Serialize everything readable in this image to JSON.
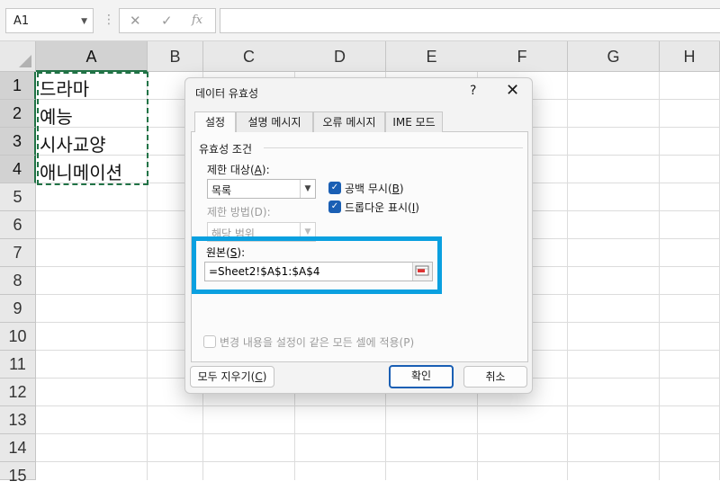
{
  "formula_bar": {
    "name_box": "A1",
    "name_box_icon": "chevron-down-icon",
    "separator": "⋮",
    "cancel_icon": "✕",
    "enter_icon": "✓",
    "fx_label": "fx",
    "formula": ""
  },
  "grid": {
    "columns": [
      "A",
      "B",
      "C",
      "D",
      "E",
      "F",
      "G",
      "H"
    ],
    "rows": [
      "1",
      "2",
      "3",
      "4",
      "5",
      "6",
      "7",
      "8",
      "9",
      "10",
      "11",
      "12",
      "13",
      "14",
      "15"
    ],
    "cells": {
      "A1": "드라마",
      "A2": "예능",
      "A3": "시사교양",
      "A4": "애니메이션"
    },
    "selected_column": "A",
    "selected_rows": [
      "1",
      "2",
      "3",
      "4"
    ],
    "accent": "#217346"
  },
  "dialog": {
    "title": "데이터 유효성",
    "help": "?",
    "close": "✕",
    "tabs": [
      {
        "label": "설정",
        "active": true
      },
      {
        "label": "설명 메시지",
        "active": false
      },
      {
        "label": "오류 메시지",
        "active": false
      },
      {
        "label": "IME 모드",
        "active": false
      }
    ],
    "section_title": "유효성 조건",
    "allow_label": "제한 대상(",
    "allow_key": "A",
    "allow_suffix": "):",
    "allow_value": "목록",
    "ignore_blank_label": "공백 무시(",
    "ignore_blank_key": "B",
    "ignore_blank_suffix": ")",
    "ignore_blank_checked": true,
    "dropdown_label": "드롭다운 표시(",
    "dropdown_key": "I",
    "dropdown_suffix": ")",
    "dropdown_checked": true,
    "data_label": "제한 방법(D):",
    "data_value": "해당 범위",
    "source_label": "원본(",
    "source_key": "S",
    "source_suffix": "):",
    "source_value": "=Sheet2!$A$1:$A$4",
    "apply_all_label": "변경 내용을 설정이 같은 모든 셀에 적용(P)",
    "apply_all_checked": false,
    "clear_all_label": "모두 지우기(",
    "clear_all_key": "C",
    "clear_all_suffix": ")",
    "ok_label": "확인",
    "cancel_label": "취소",
    "highlight_color": "#0aa0e0"
  }
}
